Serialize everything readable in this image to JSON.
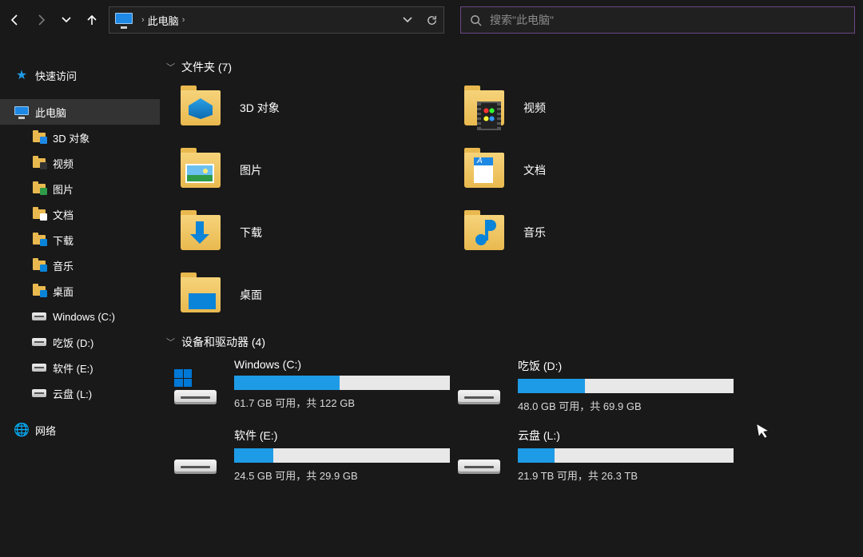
{
  "breadcrumb": {
    "location": "此电脑"
  },
  "search": {
    "placeholder": "搜索\"此电脑\""
  },
  "sidebar": {
    "quick_access": "快速访问",
    "this_pc": "此电脑",
    "network": "网络",
    "children": [
      {
        "label": "3D 对象",
        "mark": "mk-3d"
      },
      {
        "label": "视频",
        "mark": "mk-vid"
      },
      {
        "label": "图片",
        "mark": "mk-pic"
      },
      {
        "label": "文档",
        "mark": "mk-doc"
      },
      {
        "label": "下载",
        "mark": "mk-dl"
      },
      {
        "label": "音乐",
        "mark": "mk-mus"
      },
      {
        "label": "桌面",
        "mark": "mk-desk"
      }
    ],
    "drives": [
      {
        "label": "Windows (C:)"
      },
      {
        "label": "吃饭 (D:)"
      },
      {
        "label": "软件 (E:)"
      },
      {
        "label": "云盘 (L:)"
      }
    ]
  },
  "groups": {
    "folders_header": "文件夹 (7)",
    "drives_header": "设备和驱动器 (4)"
  },
  "folders": [
    {
      "label": "3D 对象",
      "overlay": "ov-3d"
    },
    {
      "label": "视频",
      "overlay": "ov-video"
    },
    {
      "label": "图片",
      "overlay": "ov-pic"
    },
    {
      "label": "文档",
      "overlay": "ov-doc"
    },
    {
      "label": "下载",
      "overlay": "ov-dl"
    },
    {
      "label": "音乐",
      "overlay": "ov-music"
    },
    {
      "label": "桌面",
      "overlay": "ov-desk"
    }
  ],
  "drives": [
    {
      "name": "Windows (C:)",
      "free_text": "61.7 GB 可用，共 122 GB",
      "used_pct": 49,
      "winflag": true
    },
    {
      "name": "吃饭 (D:)",
      "free_text": "48.0 GB 可用，共 69.9 GB",
      "used_pct": 31,
      "winflag": false
    },
    {
      "name": "软件 (E:)",
      "free_text": "24.5 GB 可用，共 29.9 GB",
      "used_pct": 18,
      "winflag": false
    },
    {
      "name": "云盘 (L:)",
      "free_text": "21.9 TB 可用，共 26.3 TB",
      "used_pct": 17,
      "winflag": false
    }
  ]
}
